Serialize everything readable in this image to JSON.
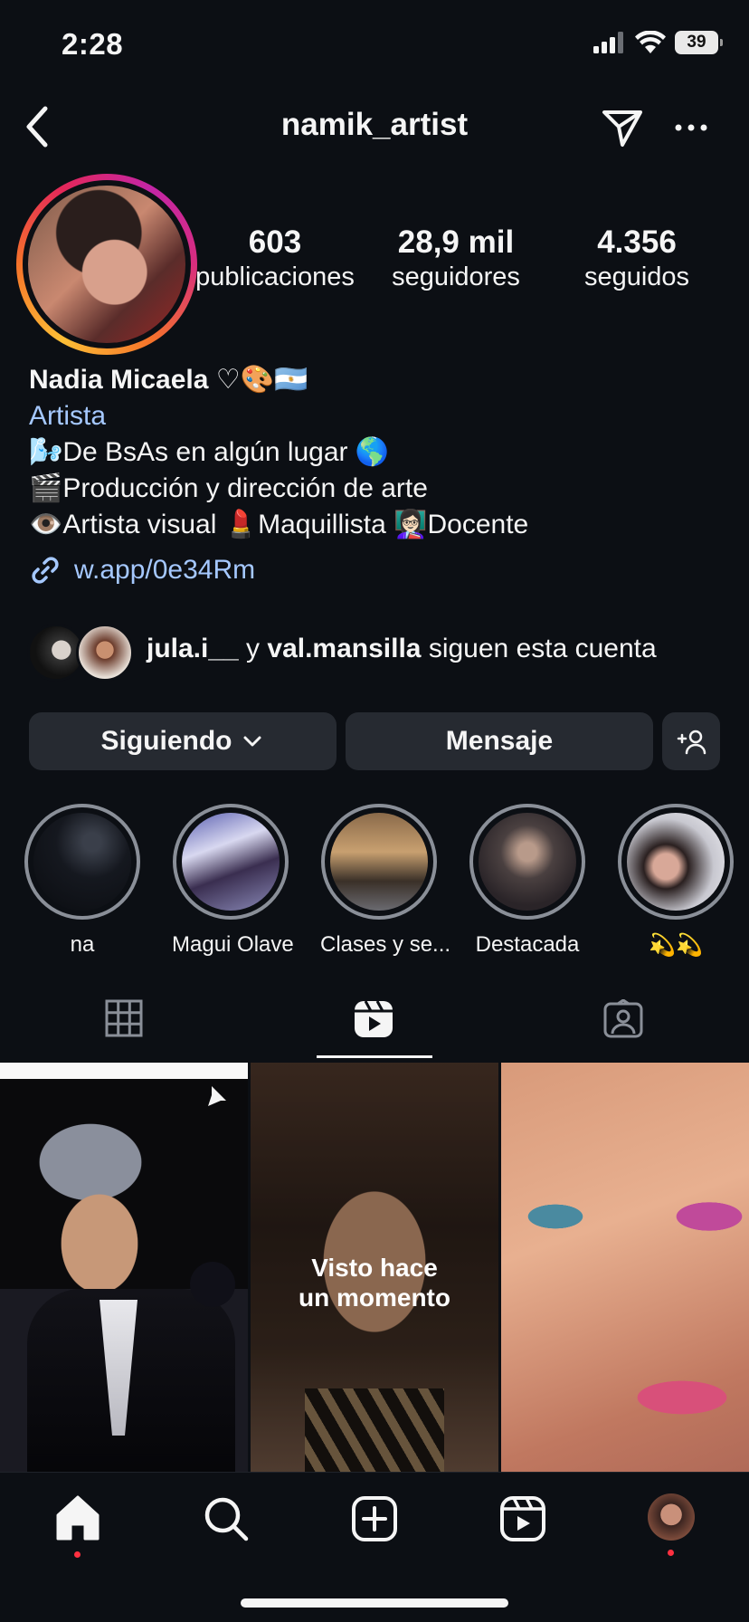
{
  "status": {
    "time": "2:28",
    "battery": "39"
  },
  "header": {
    "username": "namik_artist"
  },
  "stats": [
    {
      "num": "603",
      "label": "publicaciones"
    },
    {
      "num": "28,9 mil",
      "label": "seguidores"
    },
    {
      "num": "4.356",
      "label": "seguidos"
    }
  ],
  "bio": {
    "name": "Nadia Micaela ♡🎨🇦🇷",
    "category": "Artista",
    "lines": [
      "🌬️De BsAs en algún lugar 🌎",
      "🎬Producción y dirección de arte",
      "👁️Artista visual 💄Maquillista 👩🏻‍🏫Docente"
    ],
    "link": "w.app/0e34Rm"
  },
  "followed_by": {
    "user1": "jula.i__",
    "and": " y ",
    "user2": "val.mansilla",
    "rest": " siguen esta cuenta"
  },
  "buttons": {
    "following": "Siguiendo",
    "message": "Mensaje"
  },
  "highlights": [
    {
      "label": "na"
    },
    {
      "label": "Magui Olave"
    },
    {
      "label": "Clases y se..."
    },
    {
      "label": "Destacada"
    },
    {
      "label": "💫💫"
    }
  ],
  "tabs": [
    "grid-icon",
    "reels-icon",
    "tagged-icon"
  ],
  "active_tab": "reels",
  "grid": [
    {
      "overlay": ""
    },
    {
      "overlay": "Visto hace\nun momento"
    },
    {
      "overlay": ""
    }
  ],
  "nav": [
    "home-icon",
    "search-icon",
    "create-icon",
    "reels-icon",
    "profile-avatar"
  ],
  "colors": {
    "accent_link": "#a5c8ff",
    "notification_dot": "#ff3040",
    "button_bg": "#262a31"
  }
}
